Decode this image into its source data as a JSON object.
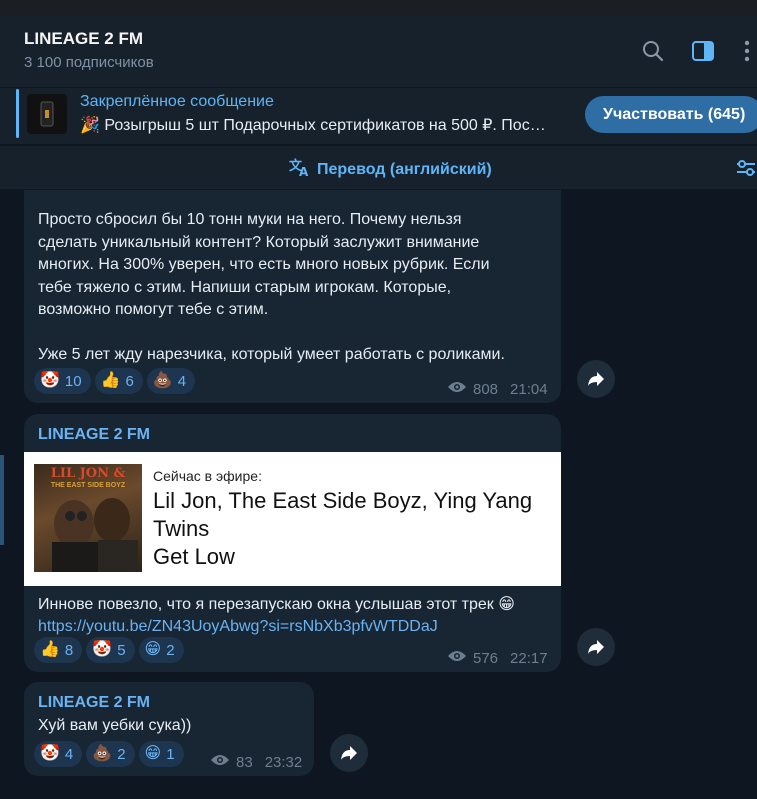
{
  "header": {
    "title": "LINEAGE 2 FM",
    "subscribers": "3 100 подписчиков",
    "icons": [
      "search-icon",
      "sidebar-toggle-icon",
      "more-vert-icon"
    ]
  },
  "pinned": {
    "title": "Закреплённое сообщение",
    "text": "🎉 Розыгрыш 5 шт Подарочных сертификатов на 500 ₽. Пос…",
    "button": "Участвовать (645)"
  },
  "translate": {
    "label": "Перевод (английский)"
  },
  "messages": [
    {
      "lines": [
        "Просто сбросил бы 10 тонн муки на него. Почему нельзя",
        "сделать уникальный контент? Который заслужит внимание",
        "многих. На 300% уверен, что есть много новых рубрик. Если",
        "тебе тяжело с этим. Напиши старым игрокам. Которые,",
        "возможно помогут тебе с этим."
      ],
      "text2": "Уже 5 лет жду нарезчика, который умеет работать с роликами.",
      "reactions": [
        {
          "emoji": "🤡",
          "count": "10"
        },
        {
          "emoji": "👍",
          "count": "6"
        },
        {
          "emoji": "💩",
          "count": "4"
        }
      ],
      "views": "808",
      "time": "21:04"
    },
    {
      "sender": "LINEAGE 2 FM",
      "card": {
        "album_title": "LIL JON &",
        "album_sub": "THE EAST SIDE BOYZ",
        "on_air": "Сейчас в эфире:",
        "line1": "Lil Jon, The East Side Boyz, Ying Yang",
        "line2": "Twins",
        "line3": "Get Low"
      },
      "text": "Иннове повезло, что я перезапускаю окна услышав этот трек 😁",
      "link": "https://youtu.be/ZN43UoyAbwg?si=rsNbXb3pfvWTDDaJ",
      "reactions": [
        {
          "emoji": "👍",
          "count": "8"
        },
        {
          "emoji": "🤡",
          "count": "5"
        },
        {
          "emoji": "😁",
          "count": "2"
        }
      ],
      "views": "576",
      "time": "22:17"
    },
    {
      "sender": "LINEAGE 2 FM",
      "text": "Хуй вам уебки сука))",
      "reactions": [
        {
          "emoji": "🤡",
          "count": "4"
        },
        {
          "emoji": "💩",
          "count": "2"
        },
        {
          "emoji": "😁",
          "count": "1"
        }
      ],
      "views": "83",
      "time": "23:32"
    }
  ],
  "colors": {
    "background": "#0e1621",
    "bubble": "#182533",
    "accent": "#5eb5f7",
    "button": "#2f6ea5"
  }
}
